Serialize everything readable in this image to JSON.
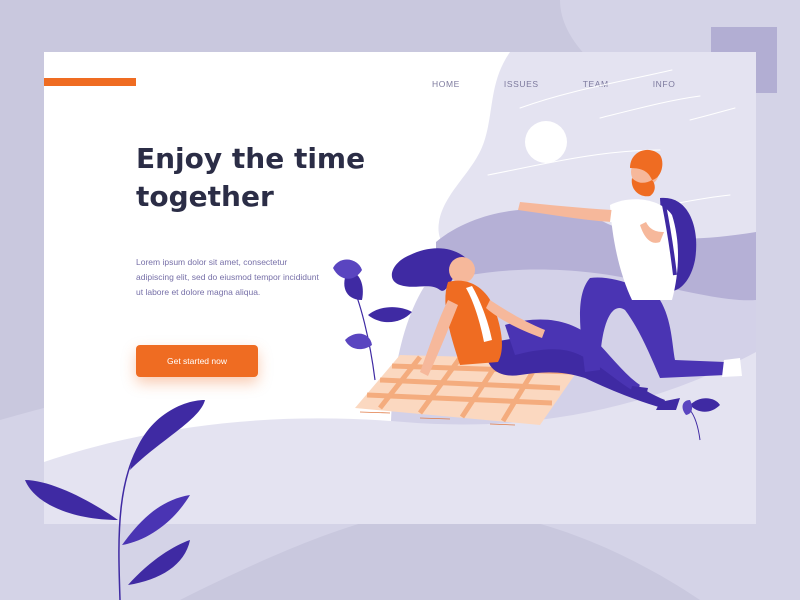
{
  "colors": {
    "background": "#c9c8de",
    "card": "#ffffff",
    "blob": "#e4e3f1",
    "accent_orange": "#ef6c22",
    "purple_dark": "#3f2aa3",
    "purple_mid": "#9d96c8",
    "heading": "#2b2d46",
    "body": "#7770a8",
    "nav": "#7d7a9e"
  },
  "nav": {
    "items": [
      {
        "label": "HOME"
      },
      {
        "label": "ISSUES"
      },
      {
        "label": "TEAM"
      },
      {
        "label": "INFO"
      }
    ]
  },
  "hero": {
    "title": "Enjoy the time together",
    "body": "Lorem ipsum dolor sit amet, consectetur adipiscing elit, sed do eiusmod tempor incididunt ut labore et dolore magna aliqua.",
    "cta_label": "Get started now"
  },
  "illustration": {
    "icons": [
      "sun-icon",
      "wind-lines-icon",
      "picnic-blanket-icon",
      "woman-sitting-figure",
      "man-kneeling-figure",
      "leaf-plant-icon"
    ]
  }
}
